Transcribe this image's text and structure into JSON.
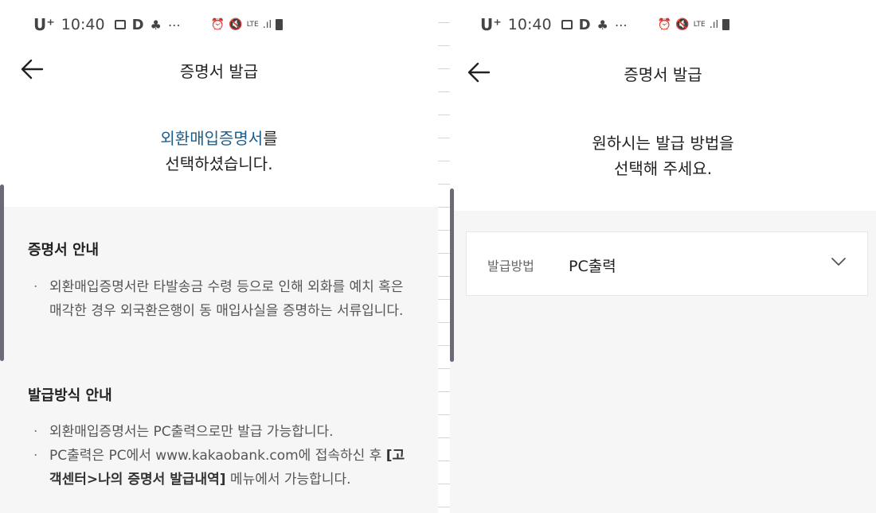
{
  "left": {
    "status": {
      "carrier": "U⁺",
      "time": "10:40",
      "icons_left": [
        "image-icon",
        "d-icon",
        "person-icon",
        "more-icon"
      ],
      "icons_right": [
        "alarm-icon",
        "mute-icon",
        "lte-icon",
        "signal-icon",
        "battery-icon"
      ],
      "lte": "LTE"
    },
    "appbar": {
      "title": "증명서 발급"
    },
    "lead": {
      "highlight": "외환매입증명서",
      "suffix": "를",
      "line2": "선택하셨습니다."
    },
    "section1": {
      "title": "증명서 안내",
      "bullets": [
        "외환매입증명서란 타발송금 수령 등으로 인해 외화를 예치 혹은 매각한 경우 외국환은행이 동 매입사실을 증명하는 서류입니다."
      ]
    },
    "section2": {
      "title": "발급방식 안내",
      "bullet1": "외환매입증명서는 PC출력으로만 발급 가능합니다.",
      "bullet2_pre": "PC출력은 PC에서 www.kakaobank.com에 접속하신 후 ",
      "bullet2_bold": "[고객센터>나의 증명서 발급내역]",
      "bullet2_post": " 메뉴에서 가능합니다."
    }
  },
  "right": {
    "status": {
      "carrier": "U⁺",
      "time": "10:40",
      "lte": "LTE"
    },
    "appbar": {
      "title": "증명서 발급"
    },
    "lead": {
      "line1": "원하시는 발급 방법을",
      "line2": "선택해 주세요."
    },
    "select": {
      "label": "발급방법",
      "value": "PC출력"
    }
  }
}
